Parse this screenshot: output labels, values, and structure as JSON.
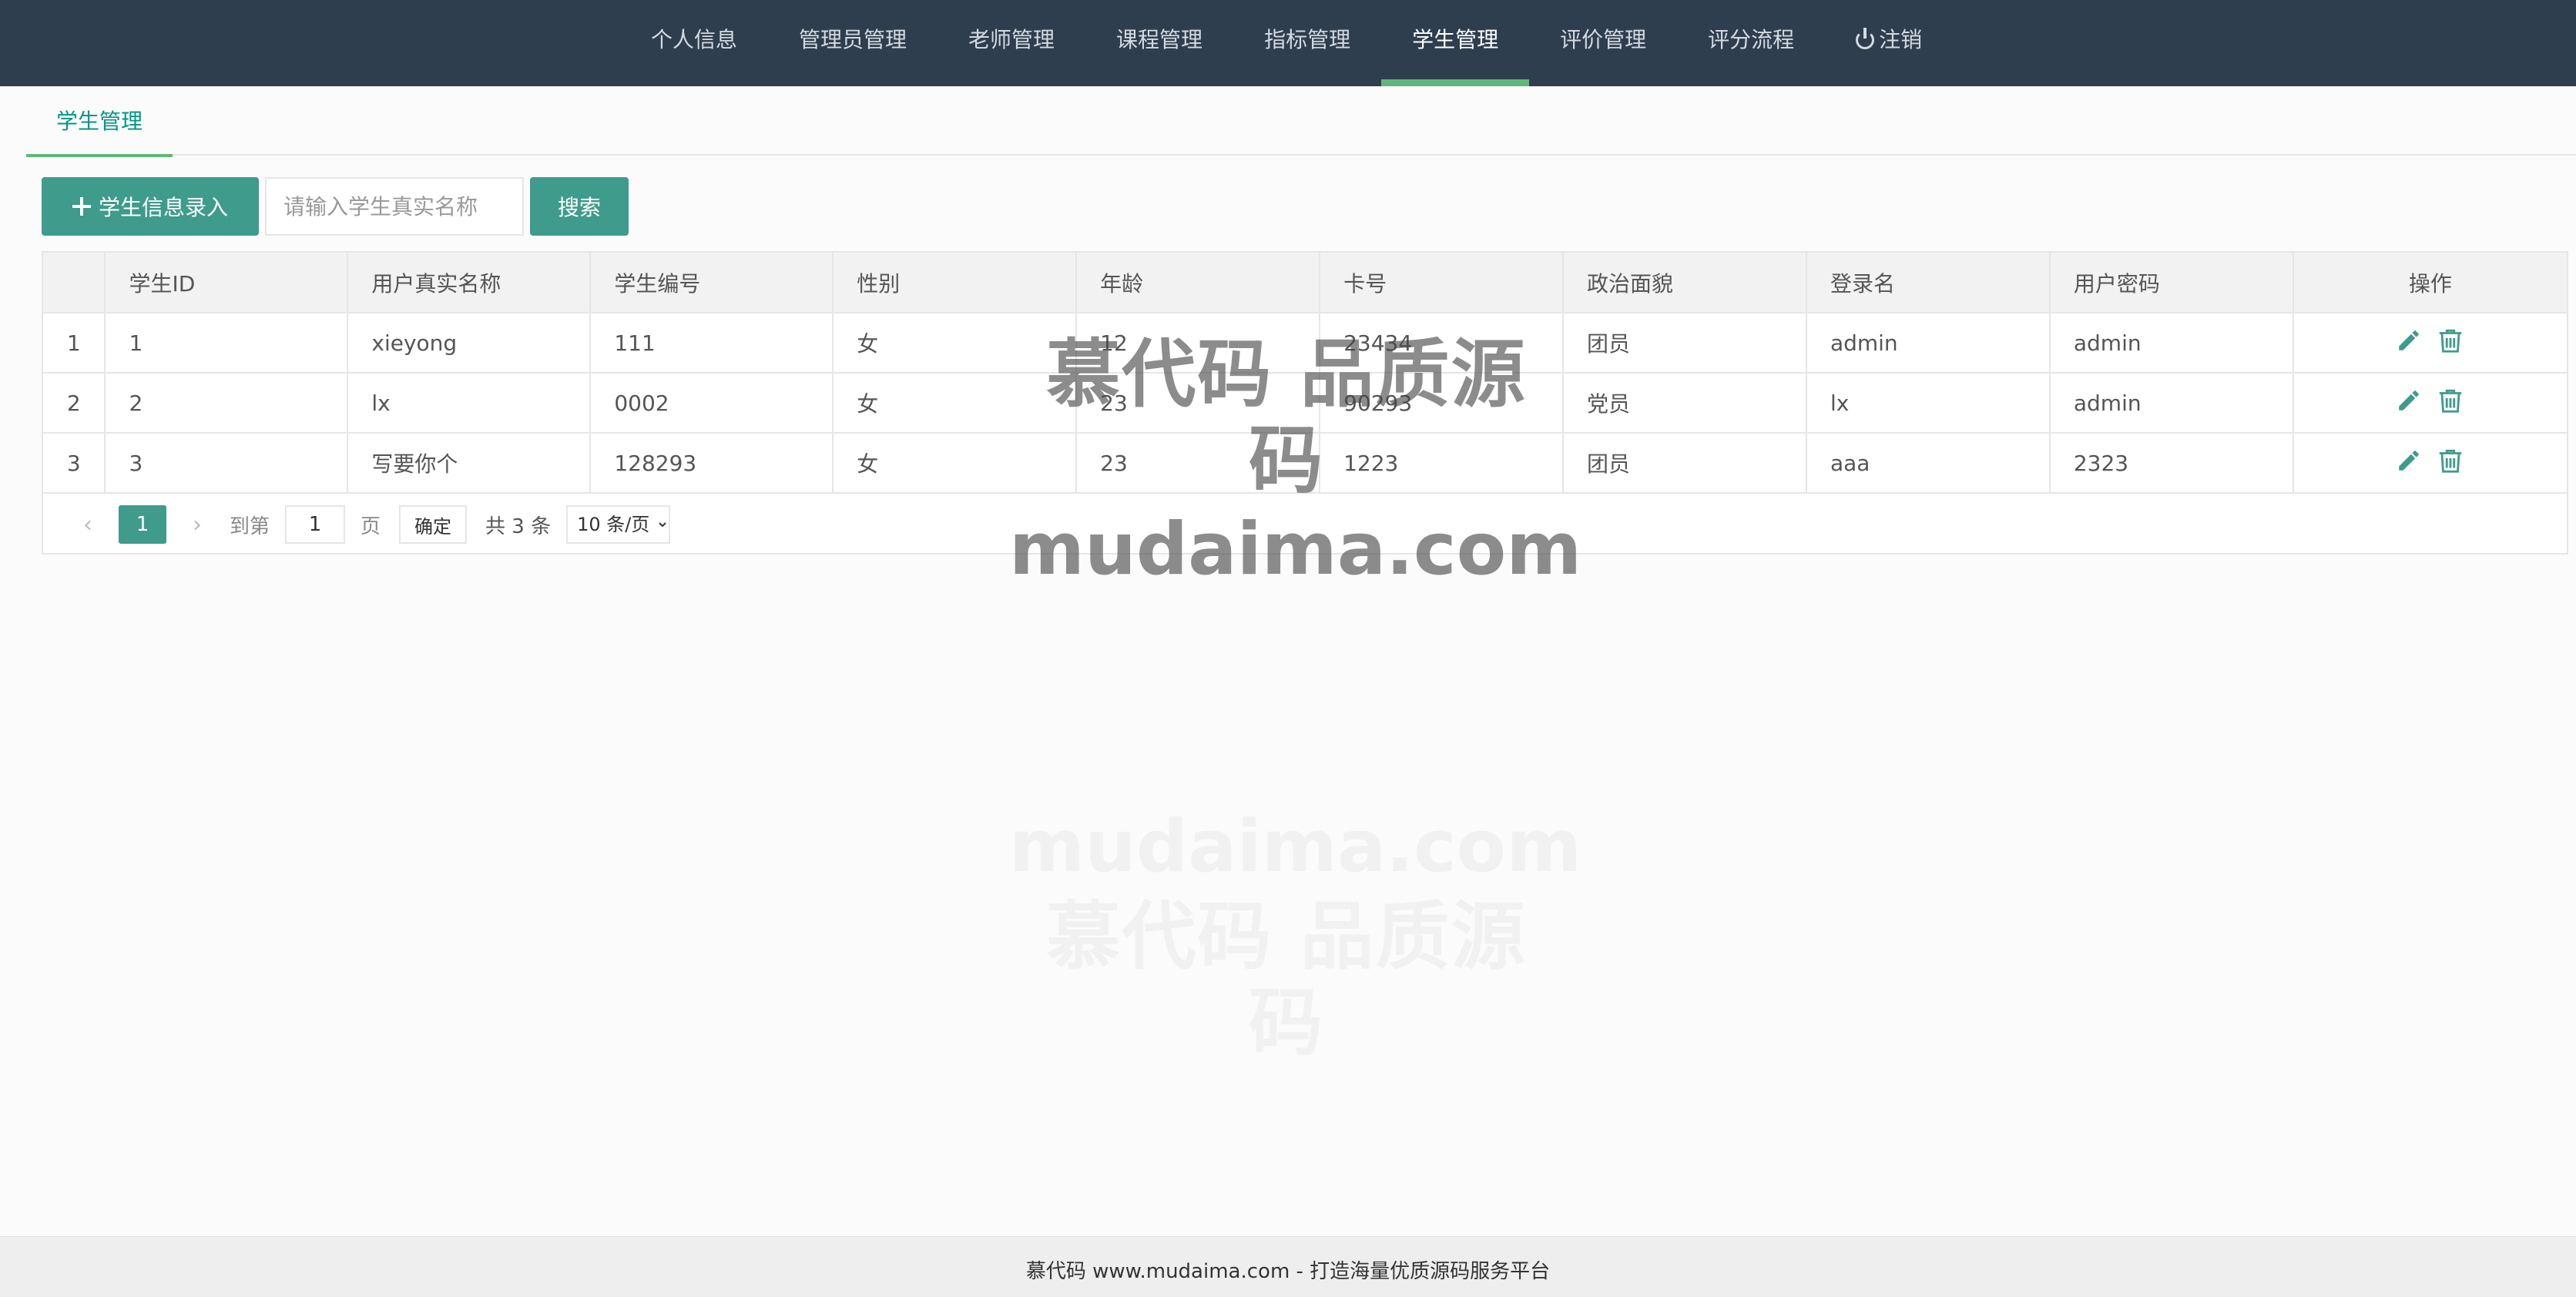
{
  "nav": {
    "items": [
      {
        "label": "个人信息"
      },
      {
        "label": "管理员管理"
      },
      {
        "label": "老师管理"
      },
      {
        "label": "课程管理"
      },
      {
        "label": "指标管理"
      },
      {
        "label": "学生管理"
      },
      {
        "label": "评价管理"
      },
      {
        "label": "评分流程"
      },
      {
        "label": "注销"
      }
    ],
    "active_index": 5
  },
  "tab": {
    "label": "学生管理"
  },
  "toolbar": {
    "add_label": "学生信息录入",
    "search_placeholder": "请输入学生真实名称",
    "search_value": "",
    "search_label": "搜索"
  },
  "table": {
    "headers": [
      "",
      "学生ID",
      "用户真实名称",
      "学生编号",
      "性别",
      "年龄",
      "卡号",
      "政治面貌",
      "登录名",
      "用户密码",
      "操作"
    ],
    "rows": [
      [
        "1",
        "1",
        "xieyong",
        "111",
        "女",
        "12",
        "23434",
        "团员",
        "admin",
        "admin"
      ],
      [
        "2",
        "2",
        "lx",
        "0002",
        "女",
        "23",
        "90293",
        "党员",
        "lx",
        "admin"
      ],
      [
        "3",
        "3",
        "写要你个",
        "128293",
        "女",
        "23",
        "1223",
        "团员",
        "aaa",
        "2323"
      ]
    ]
  },
  "pager": {
    "current_page": "1",
    "goto_prefix": "到第",
    "goto_value": "1",
    "goto_suffix": "页",
    "confirm_label": "确定",
    "total_text": "共 3 条",
    "page_size": "10 条/页"
  },
  "watermark": {
    "line1": "慕代码 品质源码",
    "line2": "mudaima.com"
  },
  "footer": {
    "text": "慕代码 www.mudaima.com - 打造海量优质源码服务平台"
  },
  "colors": {
    "nav_bg": "#2f3e4e",
    "accent": "#3f9b8b",
    "active_underline": "#5fb878"
  }
}
